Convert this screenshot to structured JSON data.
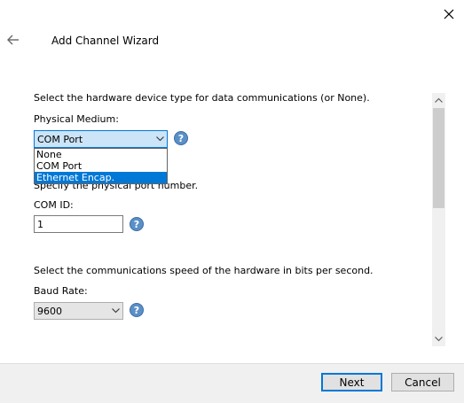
{
  "window": {
    "title": "Add Channel Wizard"
  },
  "physical_medium": {
    "description": "Select the hardware device type for data communications (or None).",
    "label": "Physical Medium:",
    "selected": "COM Port",
    "options": [
      "None",
      "COM Port",
      "Ethernet Encap."
    ],
    "highlighted_option": "Ethernet Encap."
  },
  "com_id": {
    "description": "Specify the physical port number.",
    "label": "COM ID:",
    "value": "1"
  },
  "baud_rate": {
    "description": "Select the communications speed of the hardware in bits per second.",
    "label": "Baud Rate:",
    "selected": "9600"
  },
  "help_glyph": "?",
  "buttons": {
    "next": "Next",
    "cancel": "Cancel"
  },
  "colors": {
    "accent": "#0078d7",
    "help_icon": "#5a8fc7",
    "focused_combo": "#cce4f7"
  }
}
